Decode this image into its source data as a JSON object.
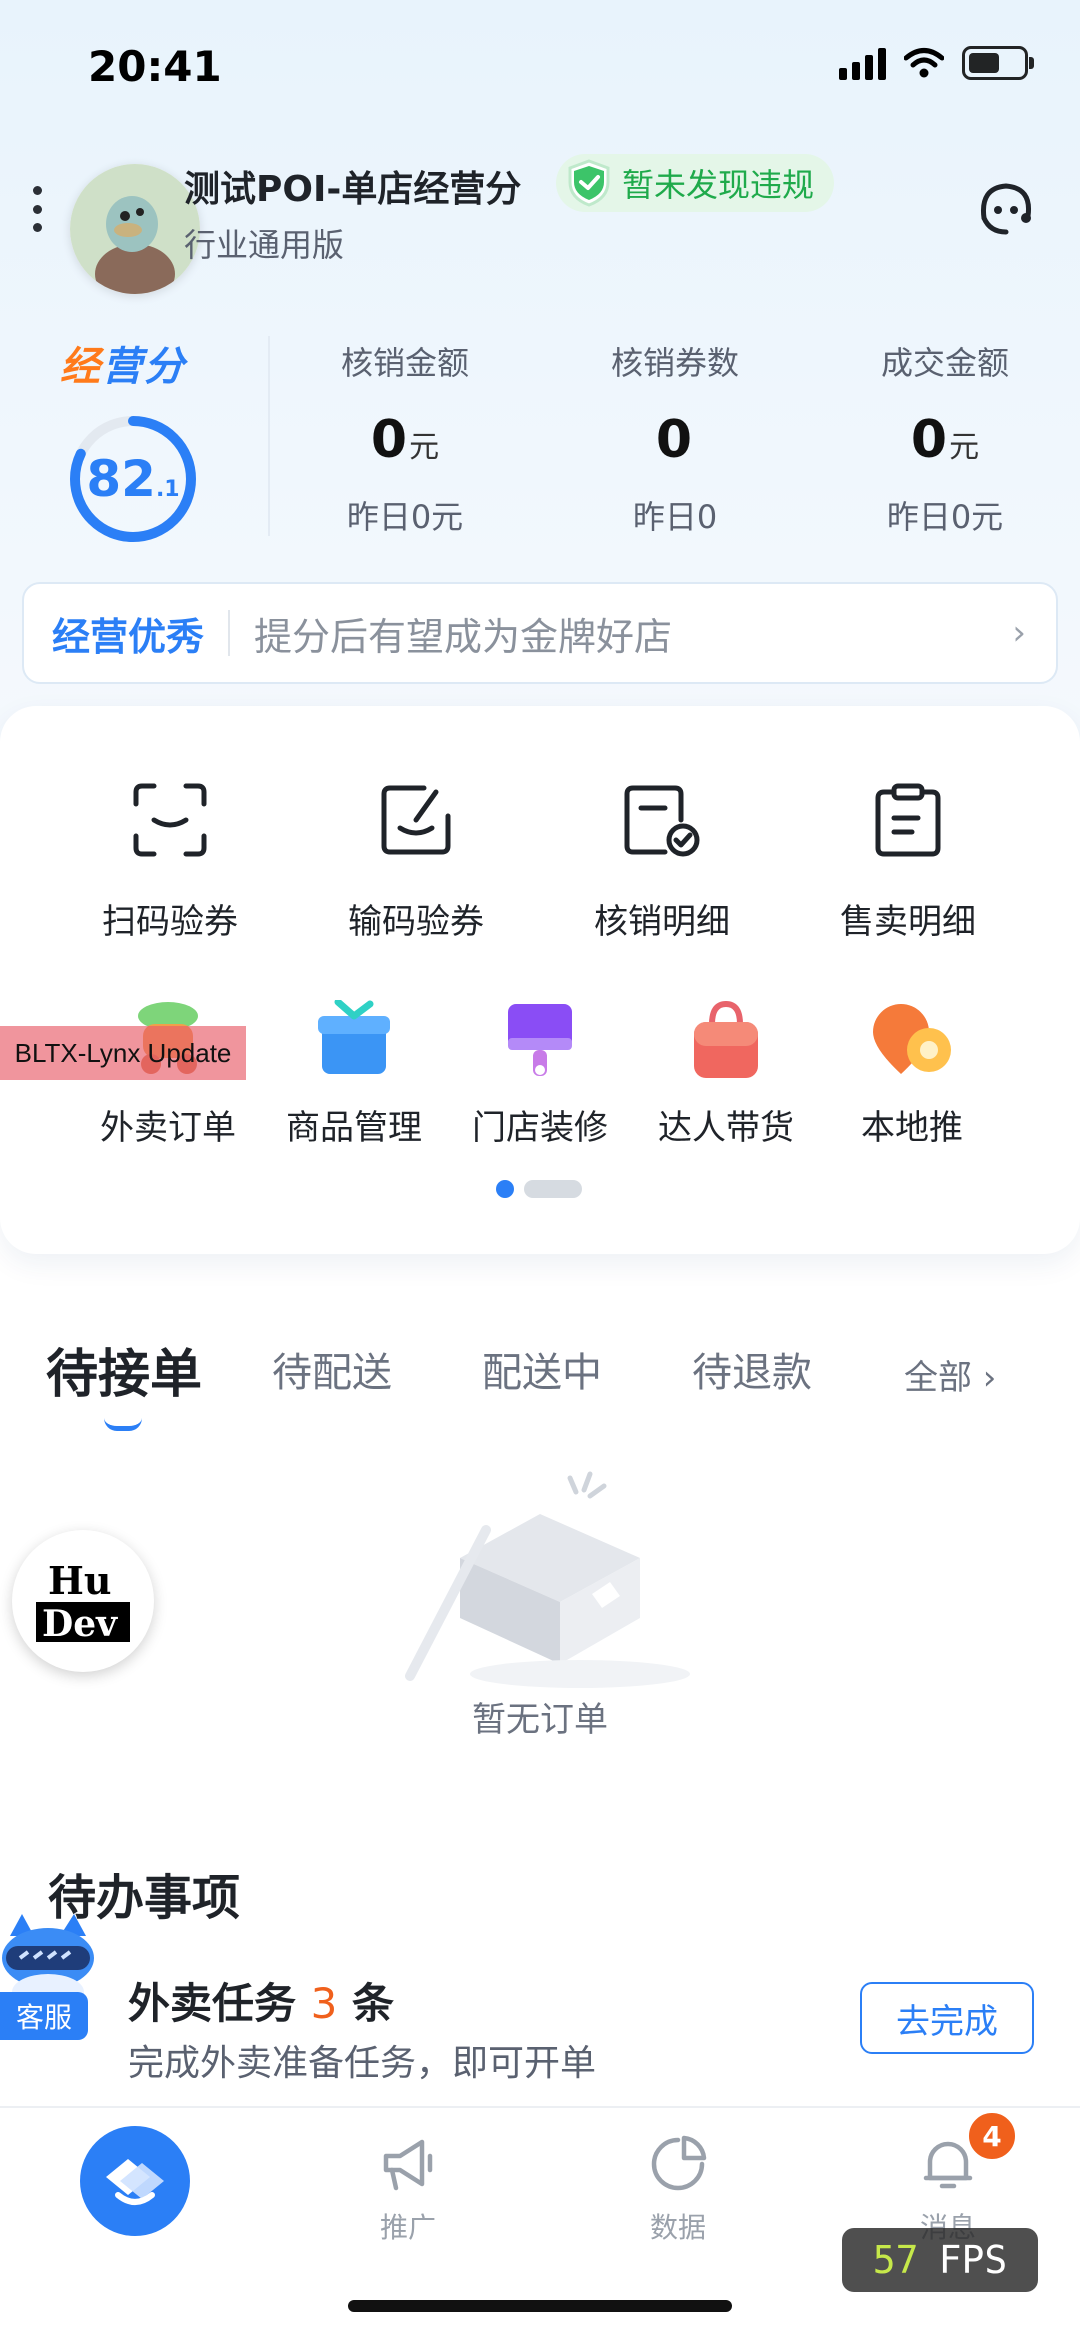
{
  "status_bar": {
    "time": "20:41"
  },
  "header": {
    "store_name": "测试POI-单店经营分",
    "store_type": "行业通用版",
    "violation_badge": "暂未发现违规"
  },
  "score": {
    "logo": "经营分",
    "value_int": "82",
    "value_dec": ".1",
    "ring_fraction": 0.821,
    "level_tag": "经营优秀",
    "level_tip": "提分后有望成为金牌好店"
  },
  "stats": [
    {
      "label": "核销金额",
      "value": "0",
      "unit": "元",
      "yesterday": "昨日0元"
    },
    {
      "label": "核销券数",
      "value": "0",
      "unit": "",
      "yesterday": "昨日0"
    },
    {
      "label": "成交金额",
      "value": "0",
      "unit": "元",
      "yesterday": "昨日0元"
    }
  ],
  "tools_row1": [
    {
      "label": "扫码验券",
      "icon": "scan-icon"
    },
    {
      "label": "输码验券",
      "icon": "edit-code-icon"
    },
    {
      "label": "核销明细",
      "icon": "verify-detail-icon"
    },
    {
      "label": "售卖明细",
      "icon": "sales-detail-icon"
    }
  ],
  "tools_row2": [
    {
      "label": "外卖订单",
      "icon": "scooter-icon"
    },
    {
      "label": "商品管理",
      "icon": "gift-box-icon"
    },
    {
      "label": "门店装修",
      "icon": "paint-roller-icon"
    },
    {
      "label": "达人带货",
      "icon": "shopping-bag-icon"
    },
    {
      "label": "本地推",
      "icon": "location-pin-icon"
    }
  ],
  "debug_label": "BLTX-Lynx Update",
  "order_tabs": {
    "items": [
      "待接单",
      "待配送",
      "配送中",
      "待退款"
    ],
    "all": "全部 ›",
    "active_index": 0
  },
  "empty_state": "暂无订单",
  "hudev_label": [
    "Hu",
    "Dev"
  ],
  "todo": {
    "title": "待办事项",
    "item_prefix": "外卖任务",
    "item_count": "3",
    "item_suffix": "条",
    "item_sub": "完成外卖准备任务，即可开单",
    "button": "去完成",
    "kefu": "客服"
  },
  "bottom_nav": {
    "items": [
      "推广",
      "数据",
      "消息"
    ],
    "message_badge": "4"
  },
  "fps": {
    "value": "57",
    "unit": "FPS"
  },
  "colors": {
    "accent": "#2b7ff6",
    "success": "#1faa4b",
    "warning": "#f0601c"
  }
}
